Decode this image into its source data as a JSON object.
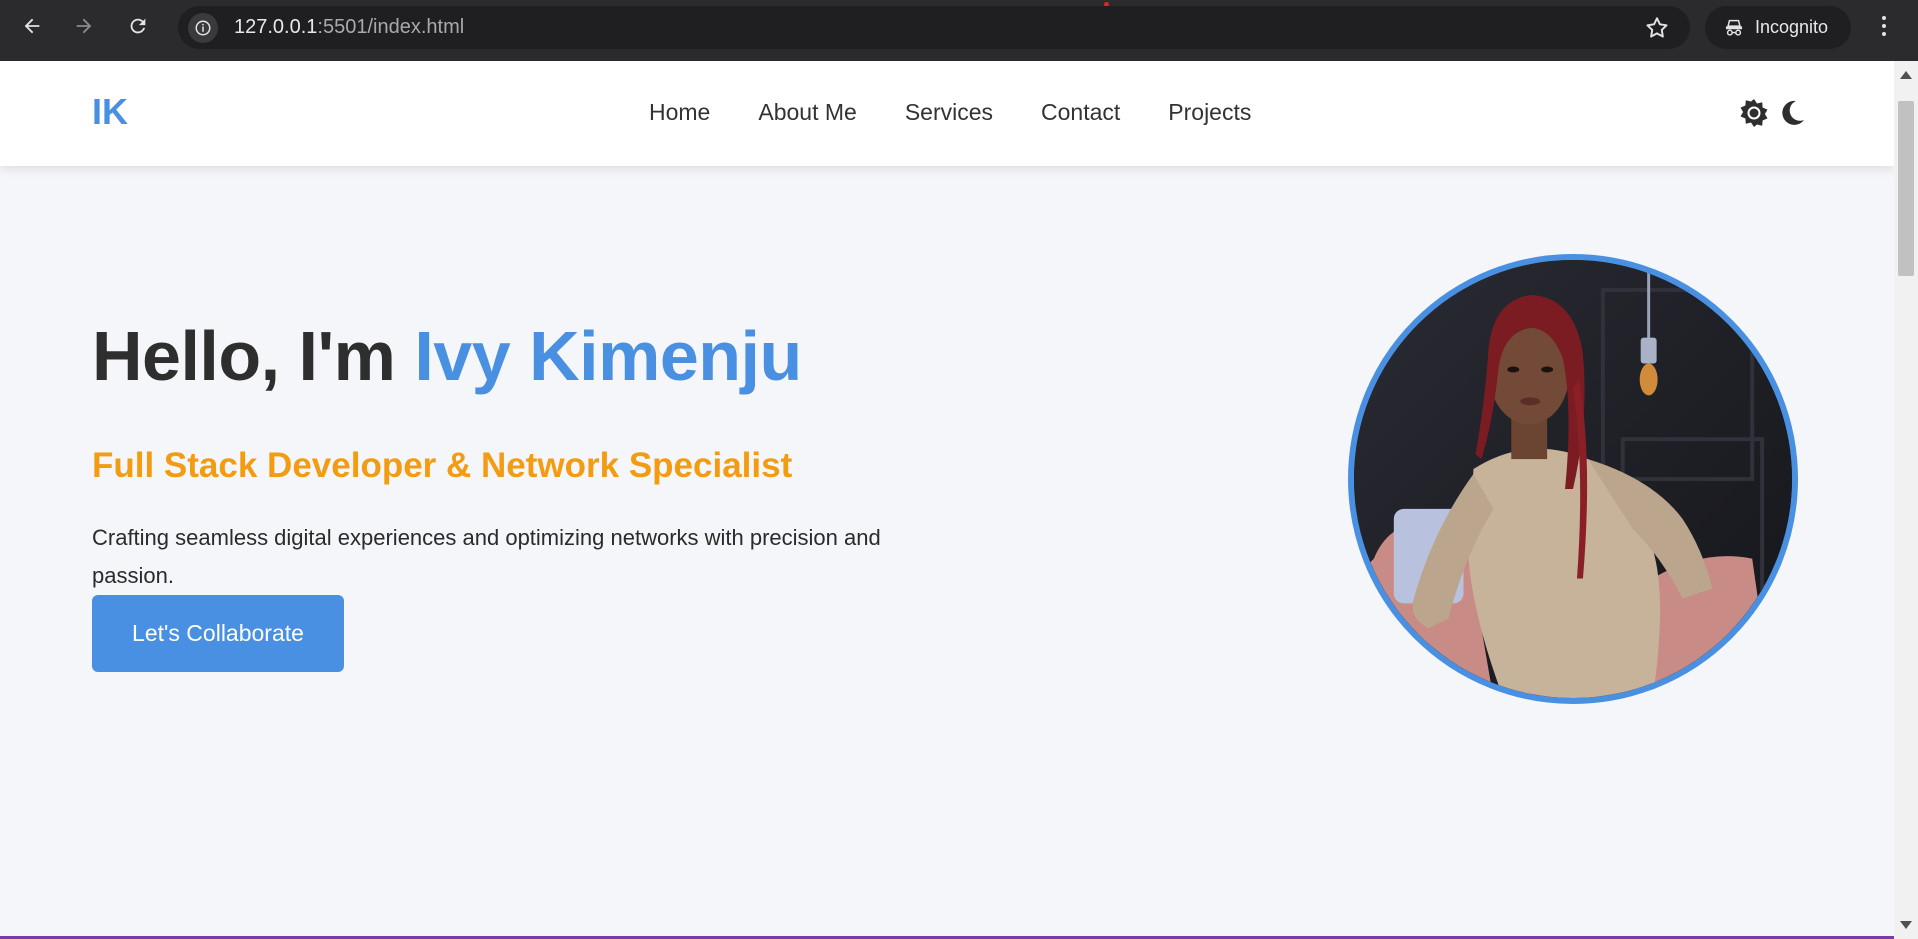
{
  "browser": {
    "url_host": "127.0.0.1",
    "url_rest": ":5501/index.html",
    "incognito_label": "Incognito",
    "icons": [
      "back-arrow-icon",
      "forward-arrow-icon",
      "reload-icon",
      "site-info-icon",
      "star-icon",
      "incognito-icon",
      "kebab-menu-icon"
    ]
  },
  "nav": {
    "logo": "IK",
    "items": [
      {
        "label": "Home"
      },
      {
        "label": "About Me"
      },
      {
        "label": "Services"
      },
      {
        "label": "Contact"
      },
      {
        "label": "Projects"
      }
    ],
    "icons": [
      "sun-icon",
      "moon-icon"
    ]
  },
  "hero": {
    "greeting": "Hello, I'm ",
    "name": "Ivy Kimenju",
    "subtitle": "Full Stack Developer & Network Specialist",
    "description": "Crafting seamless digital experiences and optimizing networks with precision and passion.",
    "cta_label": "Let's Collaborate"
  },
  "colors": {
    "accent": "#4a90e2",
    "subtitle": "#f39c12",
    "text": "#2e2e2e",
    "background": "#f5f6fa",
    "browser_chrome": "#2b2b2d"
  }
}
